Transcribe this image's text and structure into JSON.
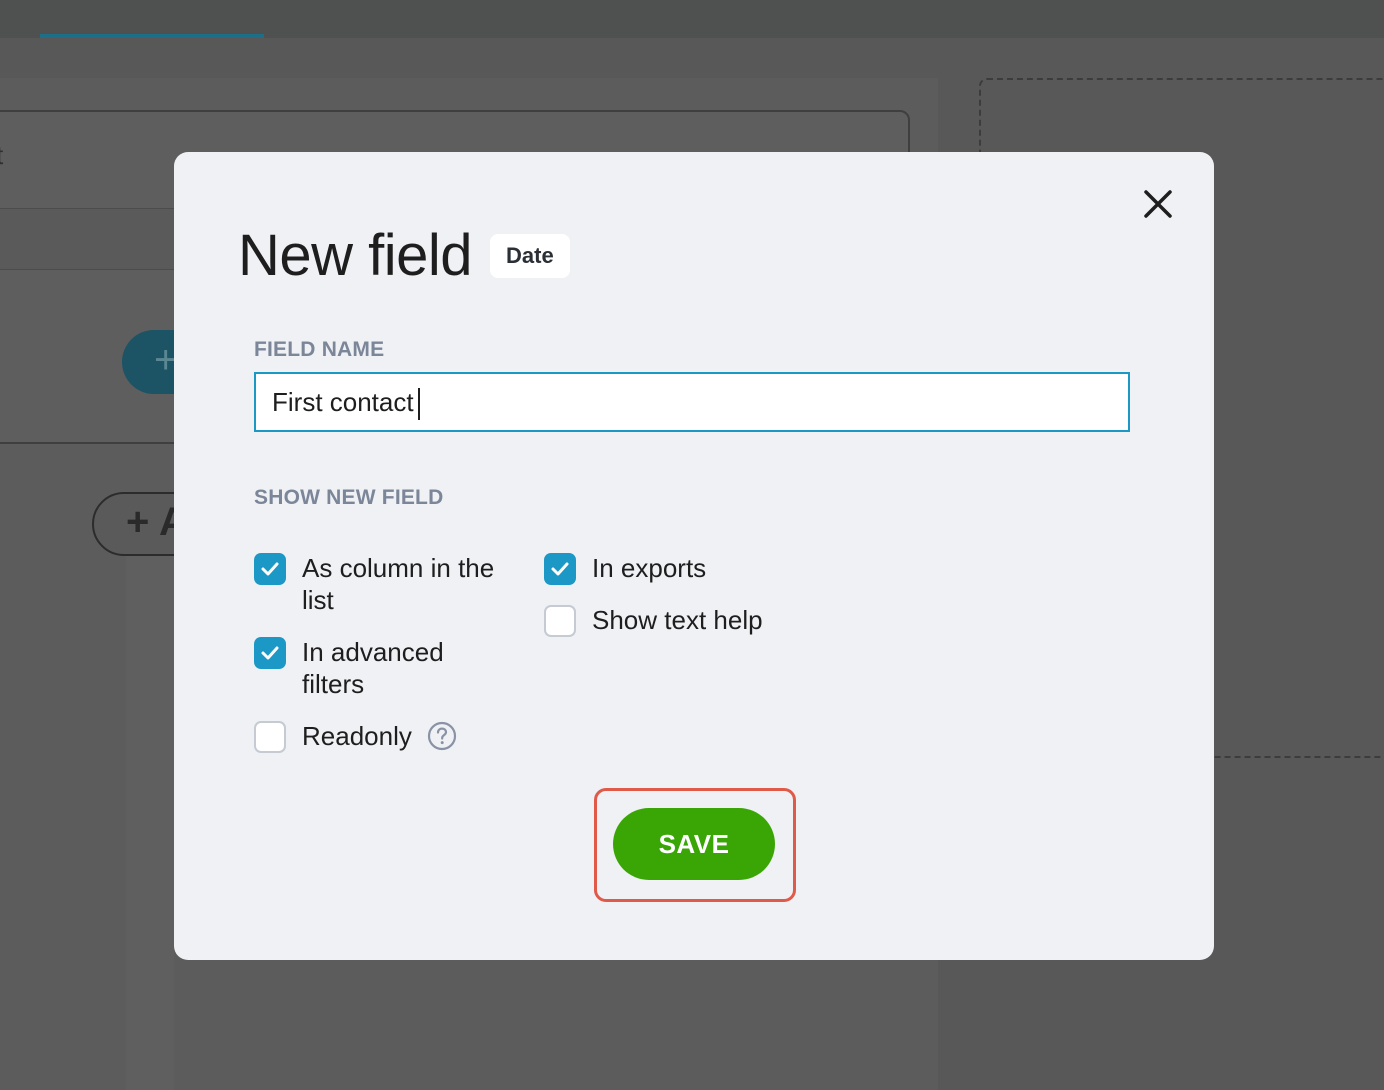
{
  "background": {
    "row_text": "t",
    "fab_symbol": "+",
    "add_button_symbol": "+ A"
  },
  "modal": {
    "title": "New field",
    "type_badge": "Date",
    "close_icon": "close-icon",
    "field_name": {
      "label": "FIELD NAME",
      "value": "First contact"
    },
    "show_section": {
      "label": "SHOW NEW FIELD",
      "options": [
        {
          "label": "As column in the",
          "label_line2": "list",
          "checked": true
        },
        {
          "label": "In advanced",
          "label_line2": "filters",
          "checked": true
        },
        {
          "label": "Readonly",
          "checked": false,
          "has_help_icon": true
        },
        {
          "label": "In exports",
          "checked": true
        },
        {
          "label": "Show text help",
          "checked": false
        }
      ]
    },
    "save_label": "SAVE"
  },
  "colors": {
    "accent": "#1b98c5",
    "save": "#3aa605",
    "highlight": "#e05a4a"
  }
}
